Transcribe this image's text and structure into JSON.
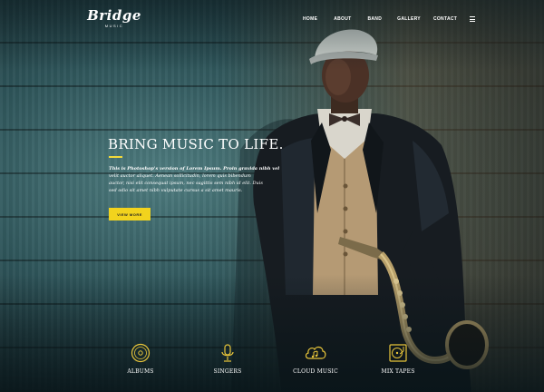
{
  "brand": {
    "name": "Bridge",
    "sub": "MUSIC"
  },
  "nav": {
    "items": [
      "HOME",
      "ABOUT",
      "BAND",
      "GALLERY",
      "CONTACT"
    ]
  },
  "hero": {
    "title": "BRING MUSIC TO LIFE.",
    "lines": [
      "This is Photoshop's version  of Lorem Ipsum. Proin gravida nibh vel",
      "velit auctor aliquet. Aenean sollicitudin, lorem quis bibendum",
      "auctor, nisi elit consequat ipsum, nec sagittis sem nibh id elit. Duis",
      "sed odio sit amet nibh vulputate cursus a sit amet mauris."
    ],
    "cta_label": "VIEW MORE"
  },
  "features": [
    {
      "label": "ALBUMS",
      "icon": "vinyl-record-icon"
    },
    {
      "label": "SINGERS",
      "icon": "microphone-icon"
    },
    {
      "label": "CLOUD MUSIC",
      "icon": "cloud-music-icon"
    },
    {
      "label": "MIX TAPES",
      "icon": "turntable-icon"
    }
  ],
  "colors": {
    "accent": "#f2d31d",
    "accent_icon": "#e8c53a",
    "text": "#ffffff"
  }
}
